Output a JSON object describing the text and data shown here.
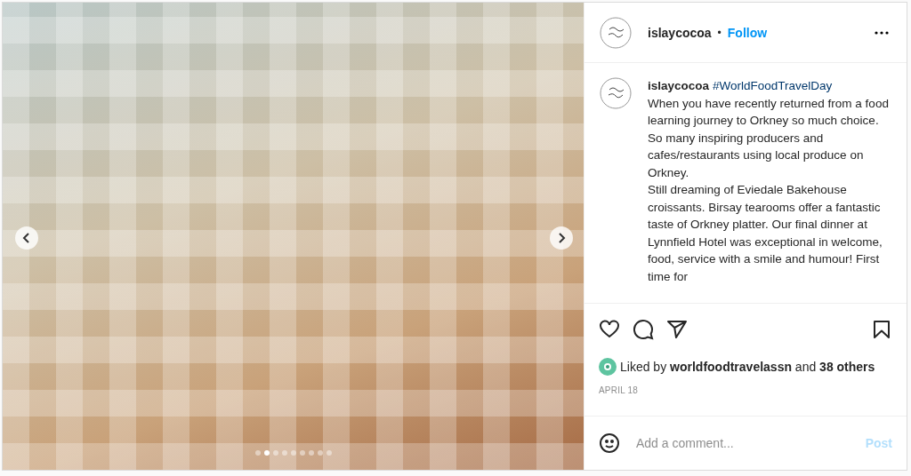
{
  "post": {
    "carousel": {
      "dots": [
        {
          "selected": false
        },
        {
          "selected": true
        },
        {
          "selected": false
        },
        {
          "selected": false
        },
        {
          "selected": false
        },
        {
          "selected": false
        },
        {
          "selected": false
        },
        {
          "selected": false
        },
        {
          "selected": false
        }
      ]
    },
    "header": {
      "username": "islaycocoa",
      "separator": "•",
      "follow": "Follow"
    },
    "caption": {
      "username": "islaycocoa",
      "hashtag": "#WorldFoodTravelDay",
      "paragraphs": [
        "When you have recently returned from a food learning journey to Orkney so much choice.",
        "So many inspiring producers and cafes/restaurants using local produce on Orkney.",
        "Still dreaming of Eviedale Bakehouse croissants. Birsay tearooms offer a fantastic taste of Orkney platter. Our final dinner at Lynnfield Hotel was exceptional in welcome, food, service with a smile and humour! First time for"
      ]
    },
    "likes": {
      "text": "Liked by **worldfoodtravelassn** and **38 others**"
    },
    "date": "APRIL 18",
    "comment": {
      "placeholder": "Add a comment...",
      "post": "Post"
    }
  }
}
